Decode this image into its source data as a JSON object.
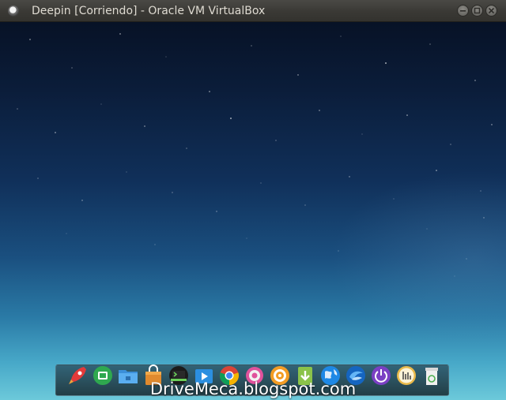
{
  "window": {
    "title": "Deepin [Corriendo] - Oracle VM VirtualBox",
    "app_icon": "virtualbox-icon",
    "controls": [
      "minimize-icon",
      "maximize-icon",
      "close-icon"
    ]
  },
  "desktop": {
    "wallpaper": "starry-night-sky",
    "colors": {
      "top": "#071226",
      "bottom": "#6cc9da"
    }
  },
  "dock": {
    "icons": [
      "launcher-rocket-icon",
      "deepin-store-icon",
      "file-manager-icon",
      "app-store-bag-icon",
      "terminal-icon",
      "movie-player-icon",
      "chrome-browser-icon",
      "settings-gear-icon",
      "music-player-icon",
      "download-manager-icon",
      "network-globe-icon",
      "deepin-wing-icon",
      "power-icon",
      "system-info-icon",
      "trash-icon"
    ]
  },
  "watermark": {
    "text": "DriveMeca.blogspot.com"
  }
}
